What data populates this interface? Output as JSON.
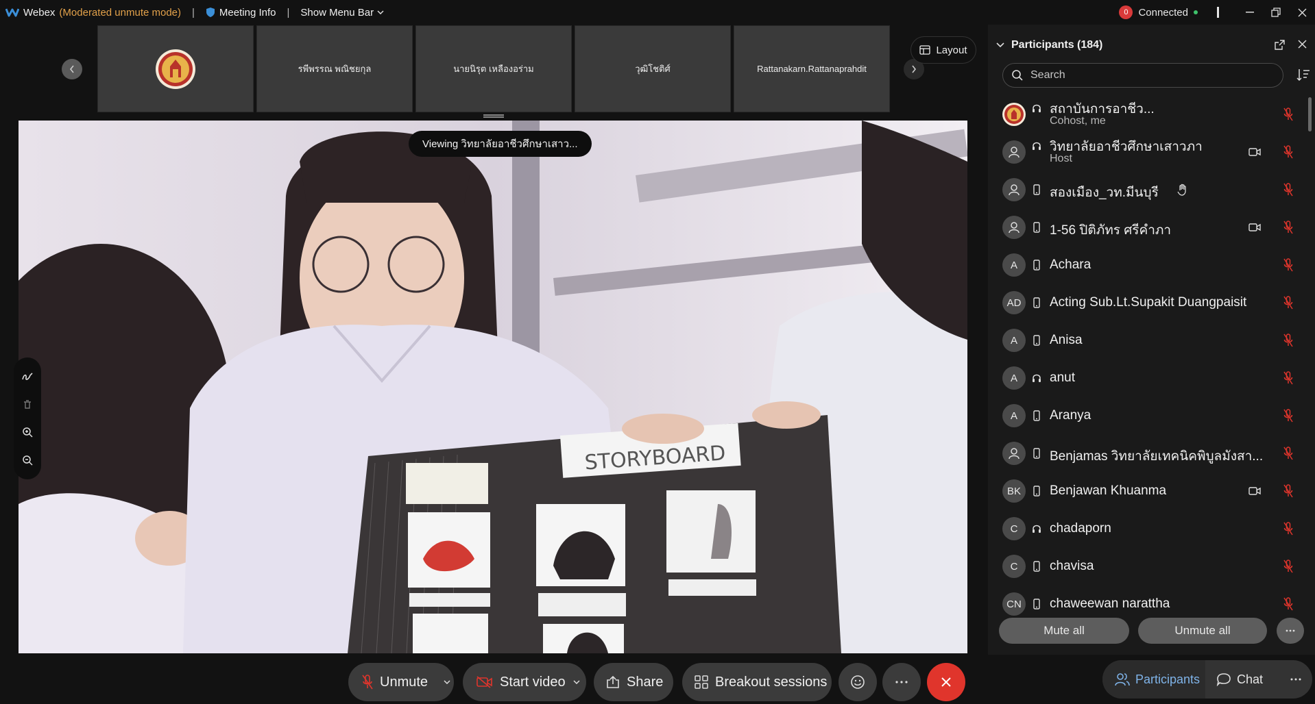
{
  "titlebar": {
    "app_name": "Webex",
    "mode": "(Moderated unmute mode)",
    "separator": "|",
    "meeting_info": "Meeting Info",
    "show_menu_bar": "Show Menu Bar",
    "connection_badge": "0",
    "connection_status": "Connected"
  },
  "thumbnails": [
    {
      "label": ""
    },
    {
      "label": "รพีพรรณ พณิชยกุล"
    },
    {
      "label": "นายนิรุต เหลืองอร่าม"
    },
    {
      "label": "วุฒิโชติศ์"
    },
    {
      "label": "Rattanakarn.Rattanaprahdit"
    }
  ],
  "layout_button": "Layout",
  "viewing_label": "Viewing วิทยาลัยอาชีวศึกษาเสาว...",
  "stage": {
    "board_title": "STORYBOARD"
  },
  "panel": {
    "title": "Participants (184)",
    "search_placeholder": "Search",
    "participants": [
      {
        "initials": "",
        "name": "สถาบันการอาชีว...",
        "role": "Cohost, me",
        "device": "headset",
        "video": false,
        "hand": false
      },
      {
        "initials": "",
        "name": "วิทยาลัยอาชีวศึกษาเสาวภา",
        "role": "Host",
        "device": "headset",
        "video": true,
        "hand": false
      },
      {
        "initials": "",
        "name": "สองเมือง_วท.มีนบุรี",
        "role": "",
        "device": "phone",
        "video": false,
        "hand": true
      },
      {
        "initials": "",
        "name": "1-56 ปิติภัทร ศรีคำภา",
        "role": "",
        "device": "phone",
        "video": true,
        "hand": false
      },
      {
        "initials": "A",
        "name": "Achara",
        "role": "",
        "device": "phone",
        "video": false,
        "hand": false
      },
      {
        "initials": "AD",
        "name": "Acting Sub.Lt.Supakit Duangpaisit",
        "role": "",
        "device": "phone",
        "video": false,
        "hand": false
      },
      {
        "initials": "A",
        "name": "Anisa",
        "role": "",
        "device": "phone",
        "video": false,
        "hand": false
      },
      {
        "initials": "A",
        "name": "anut",
        "role": "",
        "device": "headset",
        "video": false,
        "hand": false
      },
      {
        "initials": "A",
        "name": "Aranya",
        "role": "",
        "device": "phone",
        "video": false,
        "hand": false
      },
      {
        "initials": "",
        "name": "Benjamas วิทยาลัยเทคนิคพิบูลมังสา...",
        "role": "",
        "device": "phone",
        "video": false,
        "hand": false
      },
      {
        "initials": "BK",
        "name": "Benjawan Khuanma",
        "role": "",
        "device": "phone",
        "video": true,
        "hand": false
      },
      {
        "initials": "C",
        "name": "chadaporn",
        "role": "",
        "device": "headset",
        "video": false,
        "hand": false
      },
      {
        "initials": "C",
        "name": "chavisa",
        "role": "",
        "device": "phone",
        "video": false,
        "hand": false
      },
      {
        "initials": "CN",
        "name": "chaweewan narattha",
        "role": "",
        "device": "phone",
        "video": false,
        "hand": false
      }
    ],
    "mute_all": "Mute all",
    "unmute_all": "Unmute all"
  },
  "controls": {
    "unmute": "Unmute",
    "start_video": "Start video",
    "share": "Share",
    "breakout": "Breakout sessions"
  },
  "right_tabs": {
    "participants": "Participants",
    "chat": "Chat"
  },
  "colors": {
    "accent": "#7fb3e8",
    "mode": "#e2a14a",
    "end_call": "#e0352c",
    "muted": "#e0352c",
    "connected": "#3ec26b"
  }
}
